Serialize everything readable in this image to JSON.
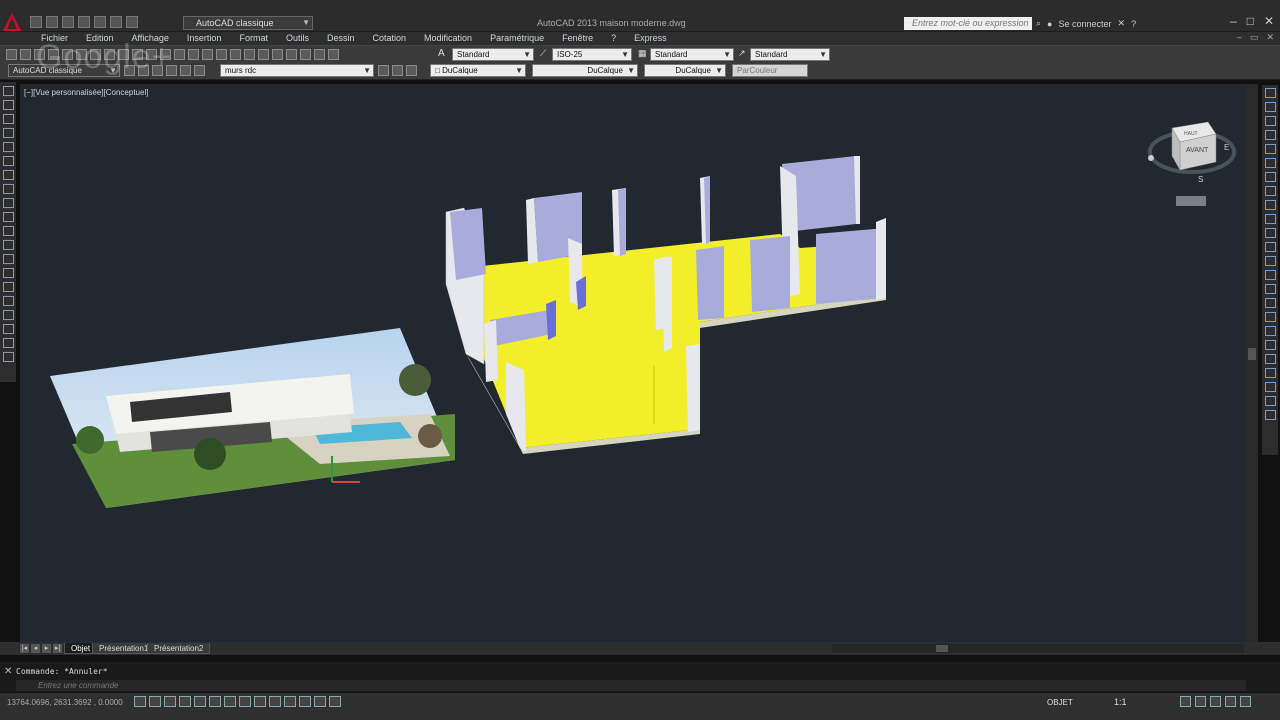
{
  "window": {
    "title": "AutoCAD 2013    maison moderne.dwg",
    "workspace": "AutoCAD classique"
  },
  "search": {
    "placeholder": "Entrez mot-clé ou expression"
  },
  "account": {
    "login_label": "Se connecter"
  },
  "menubar": {
    "items": [
      "Fichier",
      "Edition",
      "Affichage",
      "Insertion",
      "Format",
      "Outils",
      "Dessin",
      "Cotation",
      "Modification",
      "Paramétrique",
      "Fenêtre",
      "?",
      "Express"
    ]
  },
  "toolbar_styles": {
    "text_style": "Standard",
    "dim_style": "ISO-25",
    "table_style": "Standard",
    "multileader_style": "Standard"
  },
  "toolbar_layers": {
    "workspace": "AutoCAD classique",
    "layer": "murs rdc",
    "color": "DuCalque",
    "linetype": "DuCalque",
    "lineweight": "DuCalque",
    "plot_style": "ParCouleur"
  },
  "viewport": {
    "label": "[−][Vue personnalisée][Conceptuel]",
    "viewcube": {
      "face": "AVANT",
      "top": "HAUT",
      "east": "E",
      "south": "S"
    }
  },
  "tabs": [
    "Objet",
    "Présentation1",
    "Présentation2"
  ],
  "command_line": {
    "history": "Commande: *Annuler*",
    "placeholder": "Entrez une commande"
  },
  "status": {
    "coordinates": "13764.0696, 2631.3692 , 0.0000",
    "mode": "OBJET",
    "scale": "1:1"
  },
  "watermark": "Google+",
  "colors": {
    "floor": "#f2ef2a",
    "walls": "#e6e8ee",
    "wall_shade": "#a9acdb",
    "viewport_bg": "#212830"
  }
}
